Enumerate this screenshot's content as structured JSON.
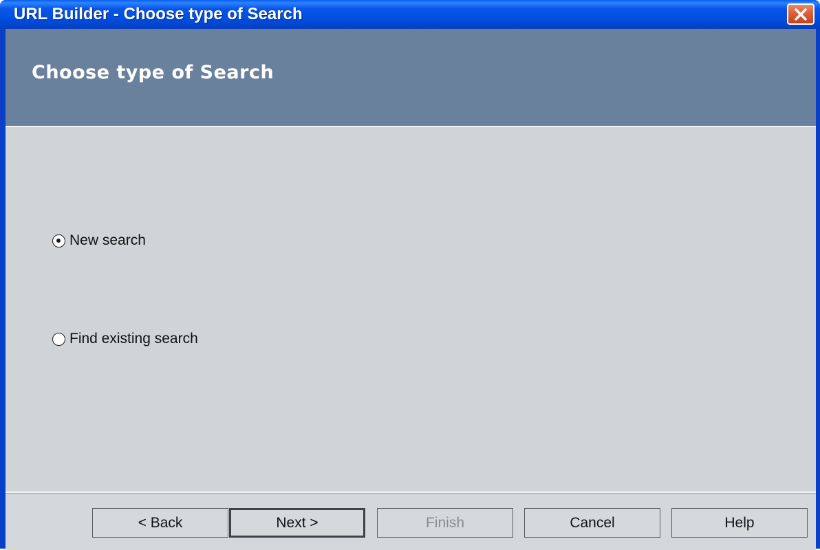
{
  "window": {
    "title": "URL Builder - Choose type of Search"
  },
  "banner": {
    "heading": "Choose type of Search"
  },
  "options": {
    "new_search": {
      "label": "New search",
      "checked": true
    },
    "find_existing": {
      "label": "Find existing search",
      "checked": false
    }
  },
  "buttons": {
    "back": "< Back",
    "next": "Next >",
    "finish": "Finish",
    "cancel": "Cancel",
    "help": "Help"
  },
  "colors": {
    "titlebar": "#0054e3",
    "banner": "#6a819d",
    "body": "#d1d4d7",
    "close": "#e0623a"
  },
  "icons": {
    "close": "close-icon"
  }
}
